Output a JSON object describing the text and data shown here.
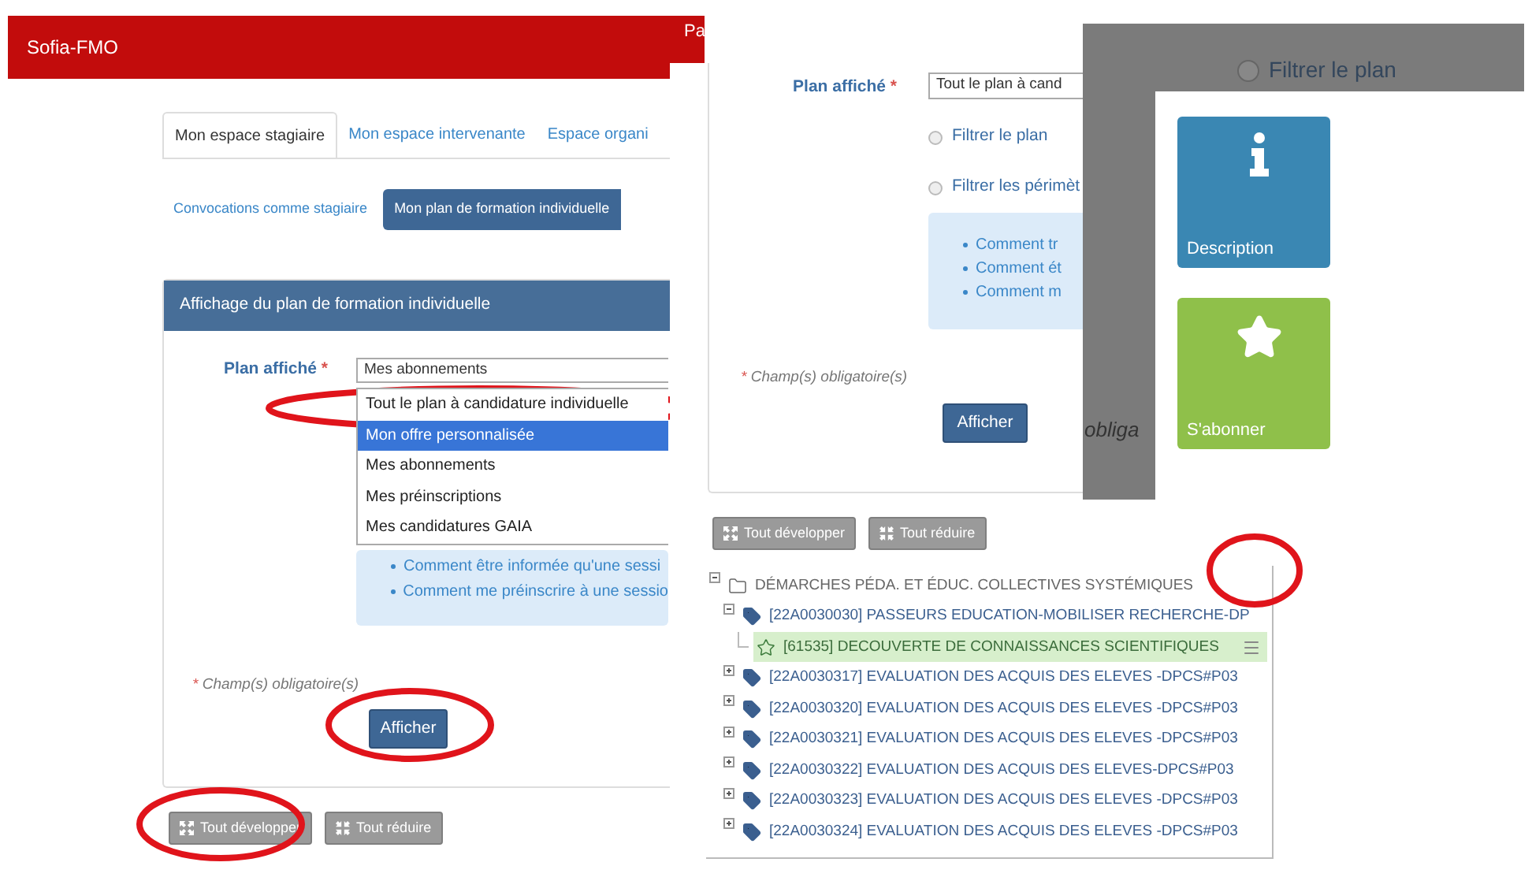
{
  "back_page": {
    "brand": "Sofia-FMO",
    "header_cut": "Pa",
    "tabs": [
      {
        "label": "Mon espace stagiaire",
        "selected": true
      },
      {
        "label": "Mon espace intervenante",
        "selected": false
      },
      {
        "label": "Espace organi",
        "selected": false
      }
    ],
    "subtabs": [
      {
        "label": "Convocations comme stagiaire",
        "selected": false
      },
      {
        "label": "Mon plan de formation individuelle",
        "selected": true
      }
    ],
    "card": {
      "title": "Affichage du plan de formation individuelle",
      "field_label": "Plan affiché",
      "field_required": "*",
      "select_value": "Mes abonnements",
      "dropdown": [
        {
          "label": "Tout le plan à candidature individuelle",
          "selected": false
        },
        {
          "label": "Mon offre personnalisée",
          "selected": true
        },
        {
          "label": "Mes abonnements",
          "selected": false
        },
        {
          "label": "Mes préinscriptions",
          "selected": false
        },
        {
          "label": "Mes candidatures GAIA",
          "selected": false
        }
      ],
      "help_links": [
        "Comment être informée qu'une sessi",
        "Comment me préinscrire à une sessio"
      ],
      "note_mark": "*",
      "note": "Champ(s) obligatoire(s)",
      "submit": "Afficher"
    },
    "buttons": [
      {
        "label": "Tout développer",
        "kind": "expand"
      },
      {
        "label": "Tout réduire",
        "kind": "collapse"
      }
    ]
  },
  "middle_page": {
    "field_label": "Plan affiché",
    "field_required": "*",
    "select_value": "Tout le plan à cand",
    "checkboxes": [
      {
        "label": "Filtrer le plan",
        "checked": false
      },
      {
        "label": "Filtrer les périmèt",
        "checked": false
      }
    ],
    "help_links": [
      "Comment tr",
      "Comment ét",
      "Comment m"
    ],
    "note_mark": "*",
    "note": "Champ(s) obligatoire(s)",
    "submit": "Afficher",
    "buttons": [
      {
        "label": "Tout développer",
        "kind": "expand"
      },
      {
        "label": "Tout réduire",
        "kind": "collapse"
      }
    ],
    "tree": [
      {
        "label": "DÉMARCHES PÉDA. ET ÉDUC. COLLECTIVES SYSTÉMIQUES",
        "kind": "folder",
        "expanded": true,
        "selected": false,
        "children": [
          {
            "label": "[22A0030030] PASSEURS EDUCATION-MOBILISER RECHERCHE-DP",
            "kind": "module",
            "expanded": true,
            "selected": false,
            "children": [
              {
                "label": "[61535] DECOUVERTE DE CONNAISSANCES SCIENTIFIQUES",
                "kind": "session",
                "selected": true
              }
            ]
          },
          {
            "label": "[22A0030317] EVALUATION DES ACQUIS DES ELEVES -DPCS#P03",
            "kind": "module",
            "expanded": false,
            "selected": false
          },
          {
            "label": "[22A0030320] EVALUATION DES ACQUIS DES ELEVES -DPCS#P03",
            "kind": "module",
            "expanded": false,
            "selected": false
          },
          {
            "label": "[22A0030321] EVALUATION DES ACQUIS DES ELEVES -DPCS#P03",
            "kind": "module",
            "expanded": false,
            "selected": false
          },
          {
            "label": "[22A0030322] EVALUATION DES ACQUIS DES ELEVES-DPCS#P03",
            "kind": "module",
            "expanded": false,
            "selected": false
          },
          {
            "label": "[22A0030323] EVALUATION DES ACQUIS DES ELEVES -DPCS#P03",
            "kind": "module",
            "expanded": false,
            "selected": false
          },
          {
            "label": "[22A0030324] EVALUATION DES ACQUIS DES ELEVES -DPCS#P03",
            "kind": "module",
            "expanded": false,
            "selected": false
          }
        ]
      }
    ]
  },
  "front_page": {
    "checkbox": {
      "label": "Filtrer le plan",
      "checked": false
    },
    "behind_text": "obliga",
    "tiles": [
      {
        "label": "Description",
        "kind": "info",
        "color": "#3a87b3"
      },
      {
        "label": "S'abonner",
        "kind": "subscribe",
        "color": "#8fc04a"
      }
    ]
  }
}
